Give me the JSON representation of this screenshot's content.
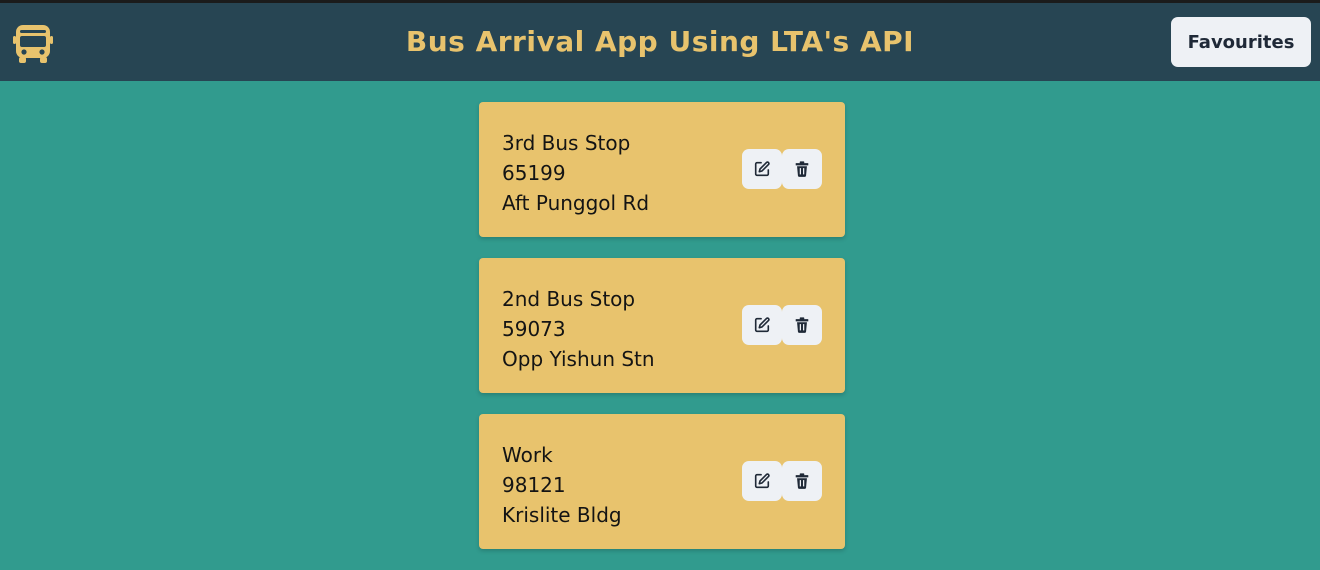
{
  "header": {
    "logo_icon": "bus-icon",
    "title": "Bus Arrival App Using LTA's API",
    "favourites_label": "Favourites"
  },
  "favourites": [
    {
      "name": "3rd Bus Stop",
      "code": "65199",
      "description": "Aft Punggol Rd",
      "edit_icon": "edit-icon",
      "delete_icon": "trash-icon"
    },
    {
      "name": "2nd Bus Stop",
      "code": "59073",
      "description": "Opp Yishun Stn",
      "edit_icon": "edit-icon",
      "delete_icon": "trash-icon"
    },
    {
      "name": "Work",
      "code": "98121",
      "description": "Krislite Bldg",
      "edit_icon": "edit-icon",
      "delete_icon": "trash-icon"
    }
  ],
  "colors": {
    "header_bg": "#274553",
    "page_bg": "#319b8e",
    "accent": "#e8c36d",
    "button_bg": "#eef1f5"
  }
}
